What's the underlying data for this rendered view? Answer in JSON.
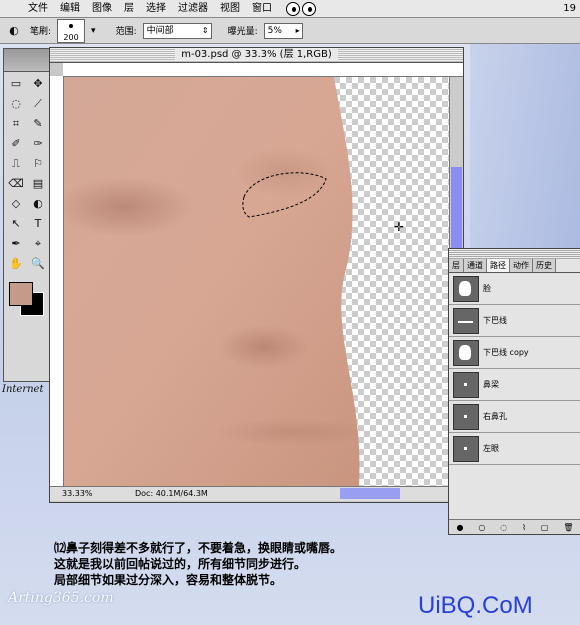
{
  "menubar": {
    "apple": "",
    "items": [
      "文件",
      "编辑",
      "图像",
      "层",
      "选择",
      "过滤器",
      "视图",
      "窗口"
    ],
    "clock": "19"
  },
  "options": {
    "brush_label": "笔刷:",
    "brush_size": "200",
    "range_label": "范围:",
    "range_value": "中间部",
    "exposure_label": "曝光量:",
    "exposure_value": "5%"
  },
  "toolbox": {
    "tools": [
      "▭",
      "✥",
      "◌",
      "⟋",
      "⌗",
      "✎",
      "✐",
      "✑",
      "⎍",
      "⚐",
      "⌫",
      "▤",
      "◇",
      "◐",
      "↖",
      "T",
      "✒",
      "⌖",
      "✋",
      "🔍"
    ],
    "label": "Internet"
  },
  "document": {
    "title": "m-03.psd @ 33.3% (层 1,RGB)",
    "zoom": "33.33%",
    "doc_info": "Doc: 40.1M/64.3M"
  },
  "paths_panel": {
    "tabs": [
      "层",
      "通道",
      "路径",
      "动作",
      "历史"
    ],
    "active_tab": "路径",
    "items": [
      {
        "label": "脸",
        "thumb": "face"
      },
      {
        "label": "下巴线",
        "thumb": "line"
      },
      {
        "label": "下巴线 copy",
        "thumb": "face"
      },
      {
        "label": "鼻梁",
        "thumb": "dot"
      },
      {
        "label": "右鼻孔",
        "thumb": "dot"
      },
      {
        "label": "左眼",
        "thumb": "dot"
      }
    ]
  },
  "caption": {
    "line1": "⑿鼻子刻得差不多就行了，不要着急，换眼睛或嘴唇。",
    "line2": "这就是我以前回帖说过的，所有细节同步进行。",
    "line3": "局部细节如果过分深入，容易和整体脱节。"
  },
  "watermarks": {
    "left": "Arting365.com",
    "right": "UiBQ.CoM"
  },
  "colors": {
    "foreground": "#c49a8a",
    "background": "#000000",
    "skin": "#d8a896"
  }
}
